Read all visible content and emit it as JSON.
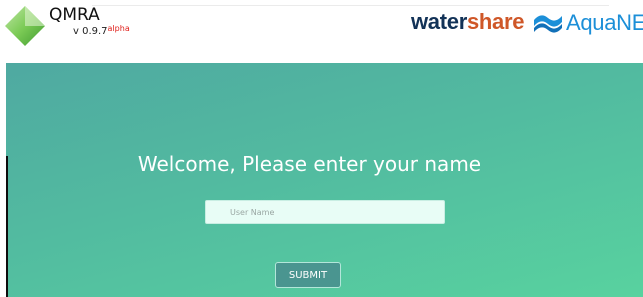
{
  "header": {
    "app_name": "QMRA",
    "version_prefix": "v 0.9.7",
    "version_suffix": "alpha",
    "partners": {
      "watershare_main": "water",
      "watershare_accent": "share",
      "aquanes": "AquaNES"
    }
  },
  "login": {
    "welcome_text": "Welcome, Please enter your name",
    "username_placeholder": "User Name",
    "username_value": "",
    "submit_label": "SUBMIT"
  },
  "colors": {
    "hero_gradient_start": "#4fa9a1",
    "hero_gradient_end": "#58d29f",
    "logo_green": "#5cb85c",
    "watershare_navy": "#123257",
    "watershare_orange": "#cf5728",
    "aquanes_blue": "#1c8fd8",
    "alpha_red": "#e0201b"
  },
  "icons": {
    "app_logo": "green-diamond-icon",
    "aquanes_logo": "water-waves-icon"
  }
}
